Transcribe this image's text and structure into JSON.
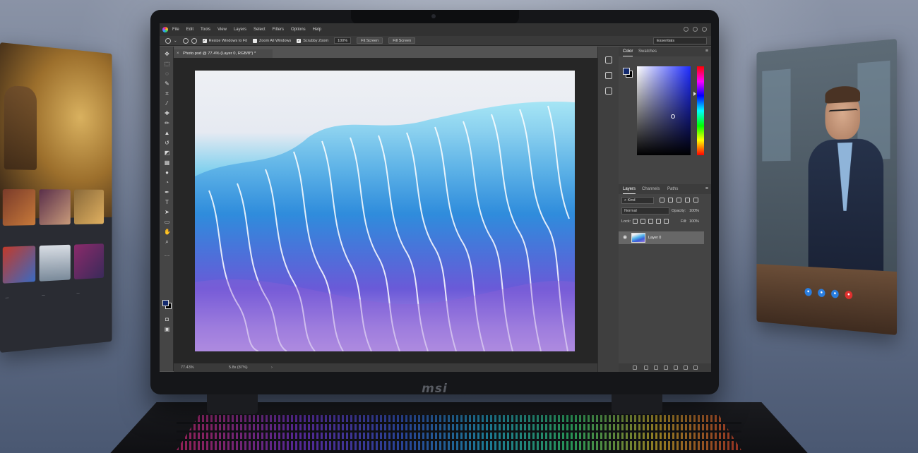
{
  "photoshop": {
    "menu": [
      "File",
      "Edit",
      "Tools",
      "View",
      "Layers",
      "Select",
      "Filters",
      "Options",
      "Help"
    ],
    "options_bar": {
      "resize_windows": "Resize Windows to Fit",
      "zoom_all_windows": "Zoom All Windows",
      "scrubby_zoom": "Scrubby Zoom",
      "zoom_value": "100%",
      "fit_screen_1": "Fit Screen",
      "fill_screen": "Fill Screen",
      "workspace": "Essentials"
    },
    "document_tab": "Photo.psd @ 77.4% (Layer 0, RGB/8*) *",
    "status": {
      "zoom": "77.43%",
      "doc_size": "5.8s (87%)",
      "arrow": "›"
    },
    "color_panel": {
      "tabs": [
        "Color",
        "Swatches"
      ],
      "foreground": "#132a6e",
      "background": "#000000"
    },
    "layers_panel": {
      "tabs": [
        "Layers",
        "Channels",
        "Paths"
      ],
      "filter": "Kind",
      "blend_mode": "Normal",
      "opacity_label": "Opacity:",
      "opacity_value": "100%",
      "lock_label": "Lock:",
      "fill_label": "Fill:",
      "fill_value": "100%",
      "layers": [
        {
          "name": "Layer 0",
          "visible": true
        }
      ]
    }
  },
  "laptop": {
    "brand": "msi"
  },
  "side_panels": {
    "left_captions": [
      "—",
      "—",
      "—"
    ]
  },
  "colors": {
    "accent_blue": "#1e2cff",
    "foreground": "#132a6e",
    "call_red": "#e0302e",
    "call_blue": "#2a7ee0"
  }
}
